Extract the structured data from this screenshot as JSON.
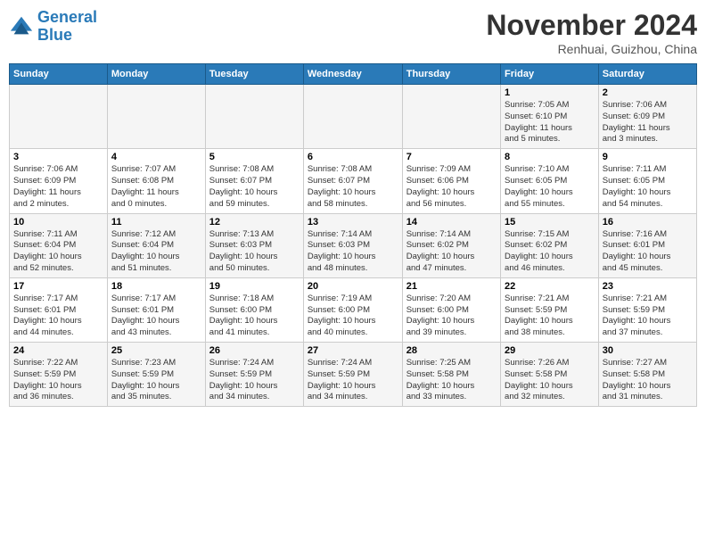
{
  "header": {
    "logo_general": "General",
    "logo_blue": "Blue",
    "month": "November 2024",
    "location": "Renhuai, Guizhou, China"
  },
  "days_of_week": [
    "Sunday",
    "Monday",
    "Tuesday",
    "Wednesday",
    "Thursday",
    "Friday",
    "Saturday"
  ],
  "weeks": [
    {
      "row_bg": "light",
      "days": [
        {
          "num": "",
          "info": ""
        },
        {
          "num": "",
          "info": ""
        },
        {
          "num": "",
          "info": ""
        },
        {
          "num": "",
          "info": ""
        },
        {
          "num": "",
          "info": ""
        },
        {
          "num": "1",
          "info": "Sunrise: 7:05 AM\nSunset: 6:10 PM\nDaylight: 11 hours\nand 5 minutes."
        },
        {
          "num": "2",
          "info": "Sunrise: 7:06 AM\nSunset: 6:09 PM\nDaylight: 11 hours\nand 3 minutes."
        }
      ]
    },
    {
      "row_bg": "dark",
      "days": [
        {
          "num": "3",
          "info": "Sunrise: 7:06 AM\nSunset: 6:09 PM\nDaylight: 11 hours\nand 2 minutes."
        },
        {
          "num": "4",
          "info": "Sunrise: 7:07 AM\nSunset: 6:08 PM\nDaylight: 11 hours\nand 0 minutes."
        },
        {
          "num": "5",
          "info": "Sunrise: 7:08 AM\nSunset: 6:07 PM\nDaylight: 10 hours\nand 59 minutes."
        },
        {
          "num": "6",
          "info": "Sunrise: 7:08 AM\nSunset: 6:07 PM\nDaylight: 10 hours\nand 58 minutes."
        },
        {
          "num": "7",
          "info": "Sunrise: 7:09 AM\nSunset: 6:06 PM\nDaylight: 10 hours\nand 56 minutes."
        },
        {
          "num": "8",
          "info": "Sunrise: 7:10 AM\nSunset: 6:05 PM\nDaylight: 10 hours\nand 55 minutes."
        },
        {
          "num": "9",
          "info": "Sunrise: 7:11 AM\nSunset: 6:05 PM\nDaylight: 10 hours\nand 54 minutes."
        }
      ]
    },
    {
      "row_bg": "light",
      "days": [
        {
          "num": "10",
          "info": "Sunrise: 7:11 AM\nSunset: 6:04 PM\nDaylight: 10 hours\nand 52 minutes."
        },
        {
          "num": "11",
          "info": "Sunrise: 7:12 AM\nSunset: 6:04 PM\nDaylight: 10 hours\nand 51 minutes."
        },
        {
          "num": "12",
          "info": "Sunrise: 7:13 AM\nSunset: 6:03 PM\nDaylight: 10 hours\nand 50 minutes."
        },
        {
          "num": "13",
          "info": "Sunrise: 7:14 AM\nSunset: 6:03 PM\nDaylight: 10 hours\nand 48 minutes."
        },
        {
          "num": "14",
          "info": "Sunrise: 7:14 AM\nSunset: 6:02 PM\nDaylight: 10 hours\nand 47 minutes."
        },
        {
          "num": "15",
          "info": "Sunrise: 7:15 AM\nSunset: 6:02 PM\nDaylight: 10 hours\nand 46 minutes."
        },
        {
          "num": "16",
          "info": "Sunrise: 7:16 AM\nSunset: 6:01 PM\nDaylight: 10 hours\nand 45 minutes."
        }
      ]
    },
    {
      "row_bg": "dark",
      "days": [
        {
          "num": "17",
          "info": "Sunrise: 7:17 AM\nSunset: 6:01 PM\nDaylight: 10 hours\nand 44 minutes."
        },
        {
          "num": "18",
          "info": "Sunrise: 7:17 AM\nSunset: 6:01 PM\nDaylight: 10 hours\nand 43 minutes."
        },
        {
          "num": "19",
          "info": "Sunrise: 7:18 AM\nSunset: 6:00 PM\nDaylight: 10 hours\nand 41 minutes."
        },
        {
          "num": "20",
          "info": "Sunrise: 7:19 AM\nSunset: 6:00 PM\nDaylight: 10 hours\nand 40 minutes."
        },
        {
          "num": "21",
          "info": "Sunrise: 7:20 AM\nSunset: 6:00 PM\nDaylight: 10 hours\nand 39 minutes."
        },
        {
          "num": "22",
          "info": "Sunrise: 7:21 AM\nSunset: 5:59 PM\nDaylight: 10 hours\nand 38 minutes."
        },
        {
          "num": "23",
          "info": "Sunrise: 7:21 AM\nSunset: 5:59 PM\nDaylight: 10 hours\nand 37 minutes."
        }
      ]
    },
    {
      "row_bg": "light",
      "days": [
        {
          "num": "24",
          "info": "Sunrise: 7:22 AM\nSunset: 5:59 PM\nDaylight: 10 hours\nand 36 minutes."
        },
        {
          "num": "25",
          "info": "Sunrise: 7:23 AM\nSunset: 5:59 PM\nDaylight: 10 hours\nand 35 minutes."
        },
        {
          "num": "26",
          "info": "Sunrise: 7:24 AM\nSunset: 5:59 PM\nDaylight: 10 hours\nand 34 minutes."
        },
        {
          "num": "27",
          "info": "Sunrise: 7:24 AM\nSunset: 5:59 PM\nDaylight: 10 hours\nand 34 minutes."
        },
        {
          "num": "28",
          "info": "Sunrise: 7:25 AM\nSunset: 5:58 PM\nDaylight: 10 hours\nand 33 minutes."
        },
        {
          "num": "29",
          "info": "Sunrise: 7:26 AM\nSunset: 5:58 PM\nDaylight: 10 hours\nand 32 minutes."
        },
        {
          "num": "30",
          "info": "Sunrise: 7:27 AM\nSunset: 5:58 PM\nDaylight: 10 hours\nand 31 minutes."
        }
      ]
    }
  ]
}
